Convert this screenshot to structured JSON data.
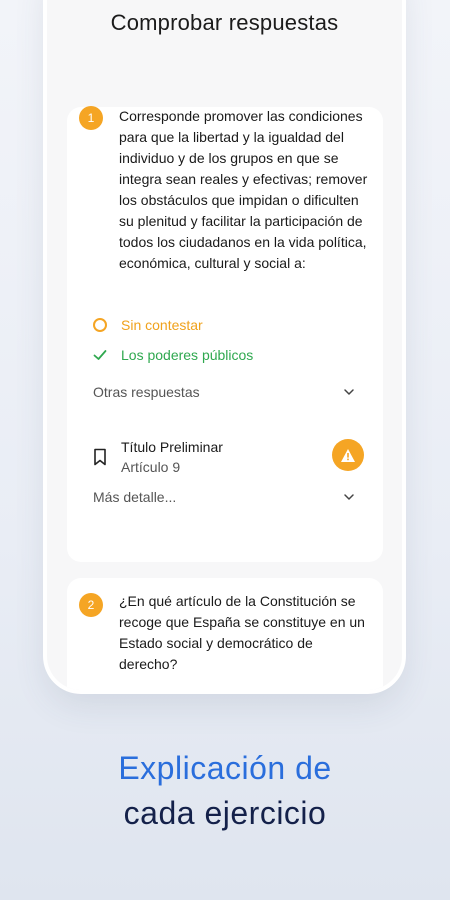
{
  "screen": {
    "title": "Comprobar respuestas"
  },
  "question1": {
    "number": "1",
    "text": "Corresponde promover las condiciones para que la libertad y la igualdad del individuo y de los grupos en que se integra sean reales y efectivas; remover los obstáculos que impidan o dificulten su plenitud y facilitar la participación de todos los ciudadanos en la vida política, económica, cultural y social a:",
    "user_answer": "Sin contestar",
    "correct_answer": "Los poderes públicos",
    "other_answers_label": "Otras respuestas",
    "reference_title": "Título Preliminar",
    "reference_article": "Artículo 9",
    "more_details_label": "Más detalle..."
  },
  "question2": {
    "number": "2",
    "text": "¿En qué artículo de la Constitución se recoge que España se constituye en un Estado social y democrático de derecho?"
  },
  "caption": {
    "line1": "Explicación de",
    "line2": "cada ejercicio"
  },
  "colors": {
    "accent": "#f5a524",
    "correct": "#2fa84f",
    "caption_blue": "#2a6edc",
    "caption_dark": "#14214a"
  },
  "icons": [
    "circle-outline-icon",
    "check-icon",
    "chevron-down-icon",
    "bookmark-icon",
    "warning-icon"
  ]
}
